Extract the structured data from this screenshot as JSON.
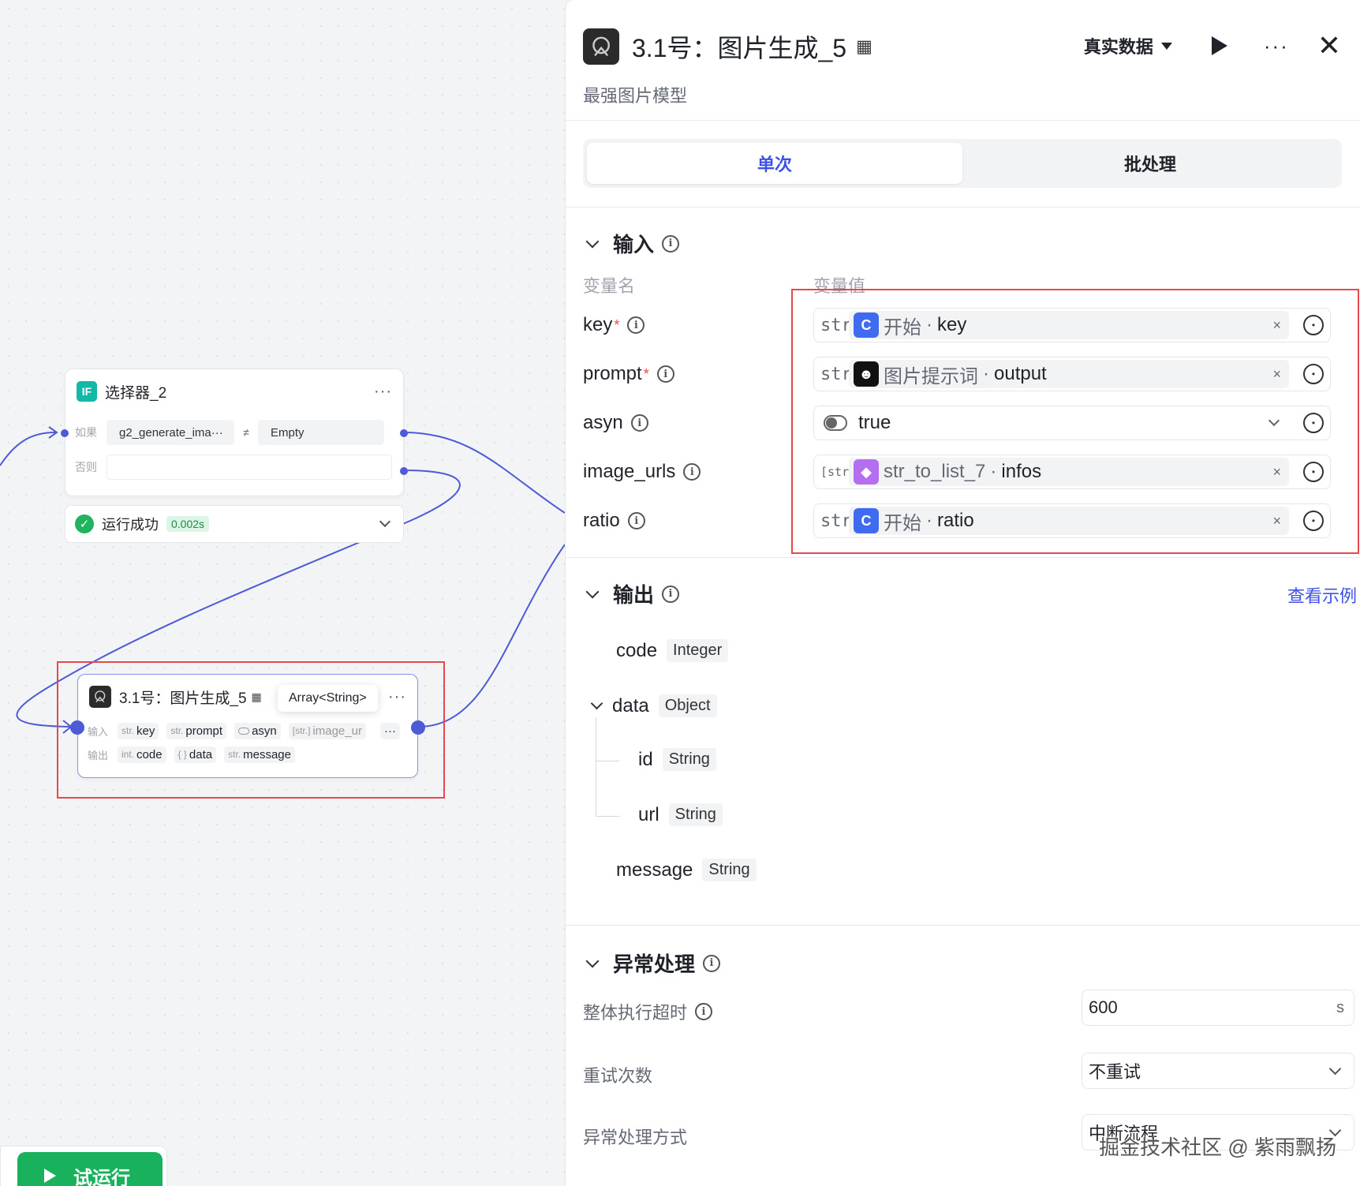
{
  "canvas": {
    "selector_node": {
      "title": "选择器_2",
      "more": "···",
      "if_label": "如果",
      "else_label": "否则",
      "left_operand": "g2_generate_ima···",
      "operator": "≠",
      "right_operand": "Empty",
      "badge": "IF"
    },
    "run_status": {
      "text": "运行成功",
      "time": "0.002s"
    },
    "image_node": {
      "title": "3.1号：图片生成_5",
      "more": "···",
      "tooltip": "Array<String>",
      "input_label": "输入",
      "output_label": "输出",
      "inputs": [
        {
          "type": "str.",
          "name": "key"
        },
        {
          "type": "str.",
          "name": "prompt"
        },
        {
          "type": "",
          "name": "asyn"
        },
        {
          "type": "[str.]",
          "name": "image_ur"
        }
      ],
      "inputs_more": "···",
      "outputs": [
        {
          "type": "int.",
          "name": "code"
        },
        {
          "type": "{ }",
          "name": "data"
        },
        {
          "type": "str.",
          "name": "message"
        }
      ]
    },
    "run_button": "试运行"
  },
  "panel": {
    "title": "3.1号：图片生成_5",
    "subtitle": "最强图片模型",
    "data_source": "真实数据",
    "more": "···",
    "close": "✕",
    "tabs": [
      {
        "label": "单次"
      },
      {
        "label": "批处理"
      }
    ],
    "input_section": {
      "title": "输入",
      "col_name": "变量名",
      "col_value": "变量值",
      "rows": [
        {
          "name": "key",
          "required": "*",
          "type": "str.",
          "source": "开始",
          "dot": "·",
          "field": "key",
          "icon": "blue"
        },
        {
          "name": "prompt",
          "required": "*",
          "type": "str.",
          "source": "图片提示词",
          "dot": "·",
          "field": "output",
          "icon": "black"
        },
        {
          "name": "asyn",
          "value": "true"
        },
        {
          "name": "image_urls",
          "type": "[str.]",
          "source": "str_to_list_7",
          "dot": "·",
          "field": "infos",
          "icon": "purple"
        },
        {
          "name": "ratio",
          "type": "str.",
          "source": "开始",
          "dot": "·",
          "field": "ratio",
          "icon": "blue"
        }
      ],
      "clear": "×"
    },
    "output_section": {
      "title": "输出",
      "example_link": "查看示例",
      "fields": [
        {
          "name": "code",
          "type": "Integer"
        },
        {
          "name": "data",
          "type": "Object"
        },
        {
          "name": "id",
          "type": "String"
        },
        {
          "name": "url",
          "type": "String"
        },
        {
          "name": "message",
          "type": "String"
        }
      ]
    },
    "exception_section": {
      "title": "异常处理",
      "timeout_label": "整体执行超时",
      "timeout_value": "600",
      "timeout_unit": "s",
      "retry_label": "重试次数",
      "retry_value": "不重试",
      "handling_label": "异常处理方式",
      "handling_value": "中断流程"
    },
    "watermark": "掘金技术社区 @ 紫雨飘扬"
  },
  "colors": {
    "accent": "#3f51e6",
    "success": "#19b15b",
    "highlight": "#e5484d",
    "wire": "#4e5bd6"
  }
}
